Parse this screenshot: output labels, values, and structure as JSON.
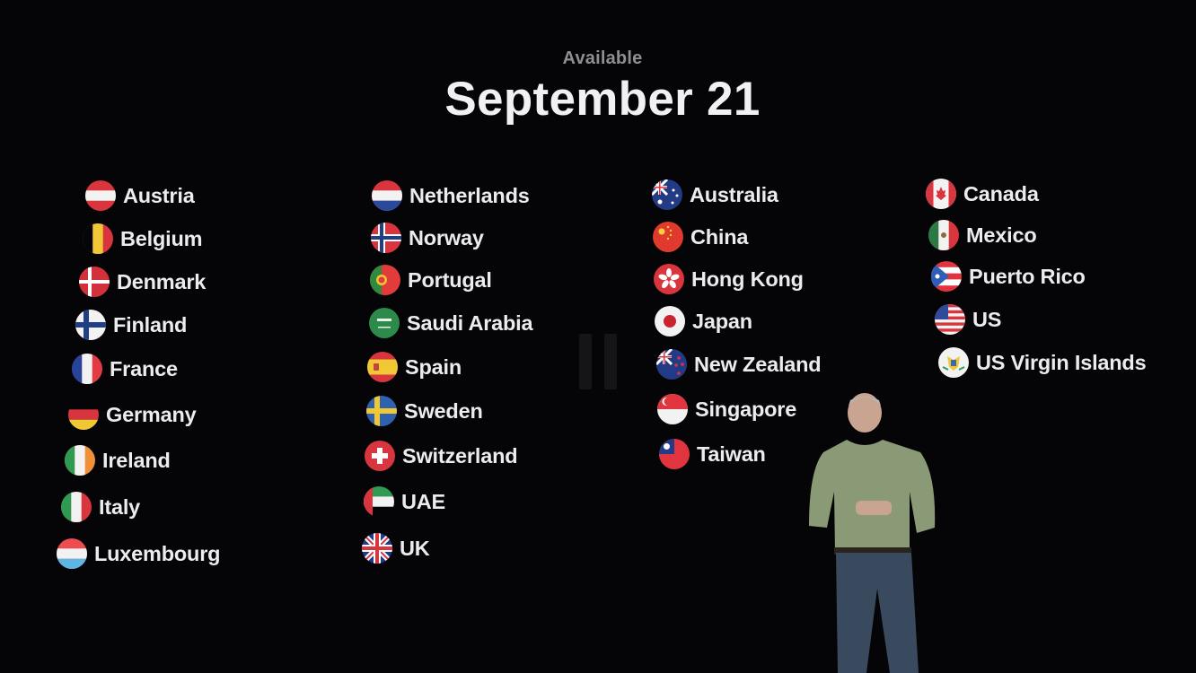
{
  "slide": {
    "subtitle": "Available",
    "title": "September 21"
  },
  "columns": [
    {
      "countries": [
        {
          "name": "Austria",
          "flag": "austria-flag-icon"
        },
        {
          "name": "Belgium",
          "flag": "belgium-flag-icon"
        },
        {
          "name": "Denmark",
          "flag": "denmark-flag-icon"
        },
        {
          "name": "Finland",
          "flag": "finland-flag-icon"
        },
        {
          "name": "France",
          "flag": "france-flag-icon"
        },
        {
          "name": "Germany",
          "flag": "germany-flag-icon"
        },
        {
          "name": "Ireland",
          "flag": "ireland-flag-icon"
        },
        {
          "name": "Italy",
          "flag": "italy-flag-icon"
        },
        {
          "name": "Luxembourg",
          "flag": "luxembourg-flag-icon"
        }
      ]
    },
    {
      "countries": [
        {
          "name": "Netherlands",
          "flag": "netherlands-flag-icon"
        },
        {
          "name": "Norway",
          "flag": "norway-flag-icon"
        },
        {
          "name": "Portugal",
          "flag": "portugal-flag-icon"
        },
        {
          "name": "Saudi Arabia",
          "flag": "saudi-arabia-flag-icon"
        },
        {
          "name": "Spain",
          "flag": "spain-flag-icon"
        },
        {
          "name": "Sweden",
          "flag": "sweden-flag-icon"
        },
        {
          "name": "Switzerland",
          "flag": "switzerland-flag-icon"
        },
        {
          "name": "UAE",
          "flag": "uae-flag-icon"
        },
        {
          "name": "UK",
          "flag": "uk-flag-icon"
        }
      ]
    },
    {
      "countries": [
        {
          "name": "Australia",
          "flag": "australia-flag-icon"
        },
        {
          "name": "China",
          "flag": "china-flag-icon"
        },
        {
          "name": "Hong Kong",
          "flag": "hong-kong-flag-icon"
        },
        {
          "name": "Japan",
          "flag": "japan-flag-icon"
        },
        {
          "name": "New Zealand",
          "flag": "new-zealand-flag-icon"
        },
        {
          "name": "Singapore",
          "flag": "singapore-flag-icon"
        },
        {
          "name": "Taiwan",
          "flag": "taiwan-flag-icon"
        }
      ]
    },
    {
      "countries": [
        {
          "name": "Canada",
          "flag": "canada-flag-icon"
        },
        {
          "name": "Mexico",
          "flag": "mexico-flag-icon"
        },
        {
          "name": "Puerto Rico",
          "flag": "puerto-rico-flag-icon"
        },
        {
          "name": "US",
          "flag": "us-flag-icon"
        },
        {
          "name": "US Virgin Islands",
          "flag": "us-virgin-islands-flag-icon"
        }
      ]
    }
  ],
  "colors": {
    "background": "#050406",
    "title": "#f1f0f4",
    "subtitle": "#8f8e93",
    "shirt": "#8a9a76",
    "jeans": "#3a4a5e"
  }
}
